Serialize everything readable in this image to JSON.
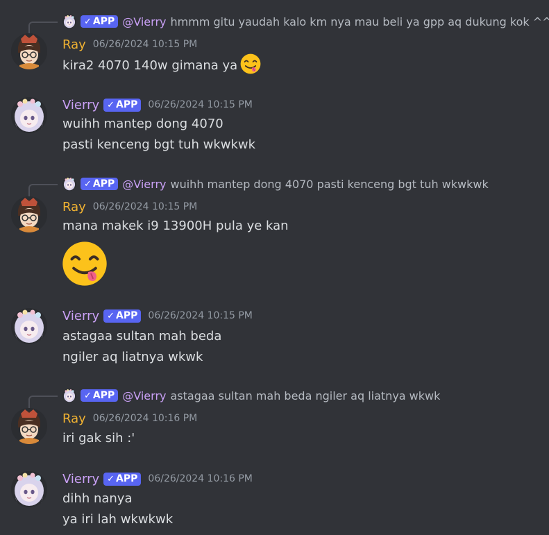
{
  "badge_label": "APP",
  "timestamp_1015": "06/26/2024 10:15 PM",
  "timestamp_1016": "06/26/2024 10:16 PM",
  "messages": [
    {
      "reply": {
        "mention": "@Vierry",
        "text": "hmmm gitu yaudah kalo km nya mau beli ya gpp aq dukung kok ^^"
      },
      "author": "Ray",
      "timestamp": "06/26/2024 10:15 PM",
      "lines": [
        "kira2 4070 140w gimana ya"
      ]
    },
    {
      "author": "Vierry",
      "timestamp": "06/26/2024 10:15 PM",
      "lines": [
        "wuihh mantep dong 4070",
        "pasti kenceng bgt tuh wkwkwk"
      ]
    },
    {
      "reply": {
        "mention": "@Vierry",
        "text": "wuihh mantep dong 4070 pasti kenceng bgt tuh wkwkwk"
      },
      "author": "Ray",
      "timestamp": "06/26/2024 10:15 PM",
      "lines": [
        "mana makek i9 13900H pula ye kan"
      ]
    },
    {
      "author": "Vierry",
      "timestamp": "06/26/2024 10:15 PM",
      "lines": [
        "astagaa sultan mah beda",
        "ngiler aq liatnya wkwk"
      ]
    },
    {
      "reply": {
        "mention": "@Vierry",
        "text": "astagaa sultan mah beda ngiler aq liatnya wkwk"
      },
      "author": "Ray",
      "timestamp": "06/26/2024 10:16 PM",
      "lines": [
        "iri gak sih :'"
      ]
    },
    {
      "author": "Vierry",
      "timestamp": "06/26/2024 10:16 PM",
      "lines": [
        "dihh nanya",
        "ya iri lah wkwkwk"
      ]
    }
  ],
  "colors": {
    "background": "#313338",
    "ray": "#f0b232",
    "vierry": "#c9a0f5",
    "badge": "#5865f2"
  },
  "icons": [
    "ray-avatar",
    "vierry-avatar",
    "verified-check-icon",
    "yum-emoji-icon"
  ]
}
